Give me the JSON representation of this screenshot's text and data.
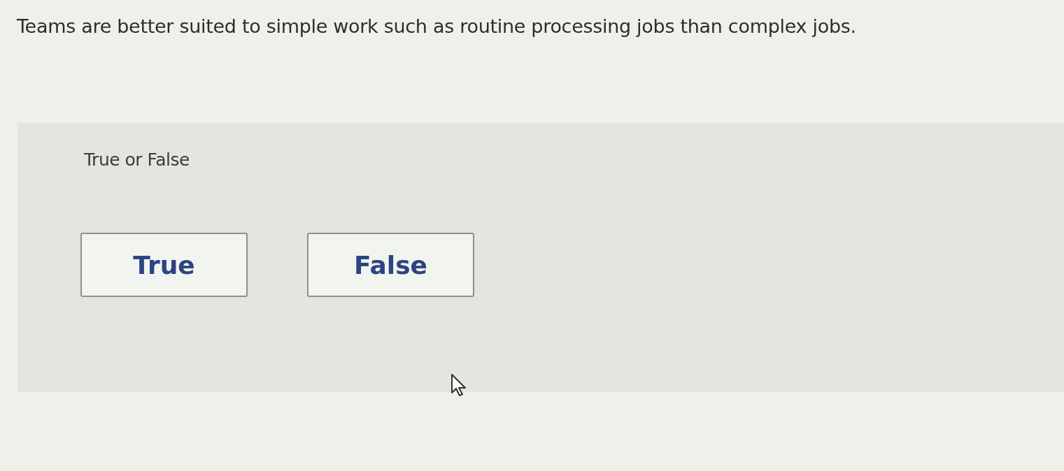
{
  "question": {
    "text": "Teams are better suited to simple work such as routine processing jobs than complex jobs."
  },
  "answer_panel": {
    "prompt": "True or False",
    "options": [
      {
        "label": "True",
        "selected": false
      },
      {
        "label": "False",
        "selected": false
      }
    ]
  }
}
